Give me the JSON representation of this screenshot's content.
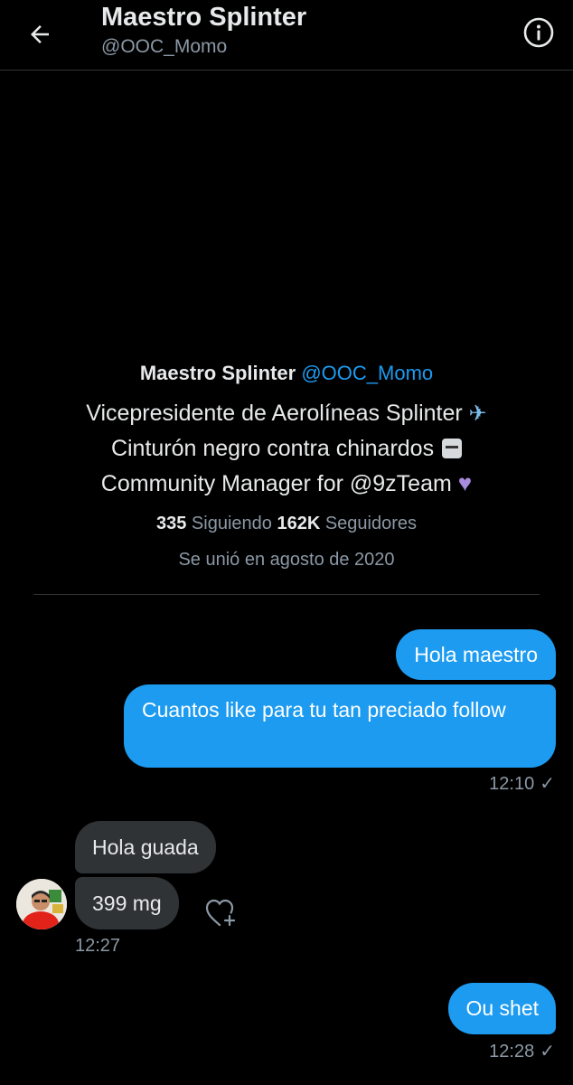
{
  "header": {
    "title": "Maestro Splinter",
    "handle": "@OOC_Momo",
    "back_icon": "arrow-left-icon",
    "info_icon": "info-icon"
  },
  "profile": {
    "name": "Maestro Splinter",
    "handle": "@OOC_Momo",
    "bio_line1": "Vicepresidente de Aerolíneas Splinter",
    "bio_line2": "Cinturón negro contra chinardos",
    "bio_line3": "Community Manager for @9zTeam",
    "following_count": "335",
    "following_label": "Siguiendo",
    "followers_count": "162K",
    "followers_label": "Seguidores",
    "joined": "Se unió en agosto de 2020"
  },
  "messages": [
    {
      "text": "Hola maestro",
      "direction": "sent"
    },
    {
      "text": "Cuantos like para tu tan preciado follow",
      "direction": "sent"
    },
    {
      "text": "Hola guada",
      "direction": "received"
    },
    {
      "text": "399 mg",
      "direction": "received"
    },
    {
      "text": "Ou shet",
      "direction": "sent"
    }
  ],
  "timestamps": {
    "t1": "12:10",
    "t2": "12:27",
    "t3": "12:28"
  },
  "colors": {
    "background": "#000000",
    "sent_bubble": "#1d9bf0",
    "received_bubble": "#2f3336",
    "accent": "#1d9bf0",
    "muted_text": "#8b98a5"
  }
}
